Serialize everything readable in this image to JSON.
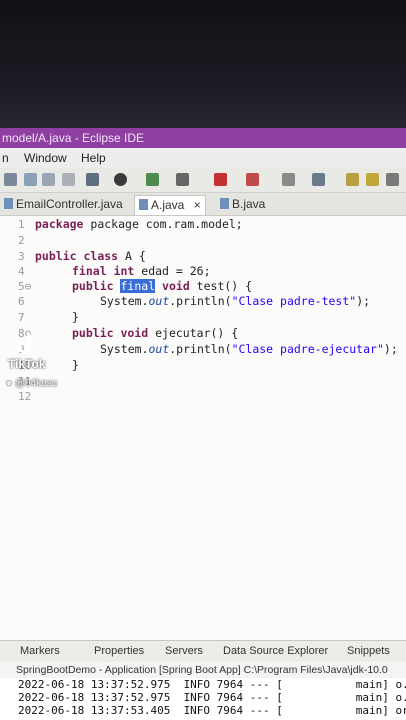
{
  "window": {
    "title": "model/A.java - Eclipse IDE"
  },
  "menu": [
    "n",
    "Window",
    "Help"
  ],
  "tabs": [
    {
      "label": "EmailController.java",
      "active": false
    },
    {
      "label": "A.java",
      "active": true,
      "close": "×"
    },
    {
      "label": "B.java",
      "active": false
    }
  ],
  "editor": {
    "line_numbers": [
      "1",
      "2",
      "3",
      "4",
      "5⊖",
      "6",
      "7",
      "8⊖",
      "9",
      "10",
      "11",
      "12"
    ],
    "line1": "package com.ram.model;",
    "line3_kw1": "public",
    "line3_kw2": "class",
    "line3_rest": " A {",
    "line4_kw1": "final",
    "line4_kw2": "int",
    "line4_rest": " edad = 26;",
    "line5_kw1": "public",
    "line5_sel": "final",
    "line5_kw2": "void",
    "line5_rest": " test() {",
    "line6_a": "System.",
    "line6_out": "out",
    "line6_b": ".println(",
    "line6_str": "\"Clase padre-test\"",
    "line6_c": ");",
    "line7": "}",
    "line8_kw1": "public",
    "line8_kw2": "void",
    "line8_rest": " ejecutar() {",
    "line9_a": "System.",
    "line9_out": "out",
    "line9_b": ".println(",
    "line9_str": "\"Clase padre-ejecutar\"",
    "line9_c": ");",
    "line10": "}"
  },
  "bottom_panel": {
    "tabs": [
      "Markers",
      "Properties",
      "Servers",
      "Data Source Explorer",
      "Snippets"
    ],
    "console_title": "SpringBootDemo - Application [Spring Boot App] C:\\Program Files\\Java\\jdk-10.0",
    "lines": [
      "2022-06-18 13:37:52.975  INFO 7964 --- [           main] o.",
      "2022-06-18 13:37:52.975  INFO 7964 --- [           main] o.",
      "2022-06-18 13:37:53.405  INFO 7964 --- [           main] or"
    ]
  },
  "overlay": {
    "brand": "TikTok",
    "handle": "@04kasu"
  },
  "colors": {
    "title_bar": "#8f3fa2",
    "selection": "#3a6ed6",
    "keyword": "#7a1f55",
    "string": "#2a00ff"
  }
}
